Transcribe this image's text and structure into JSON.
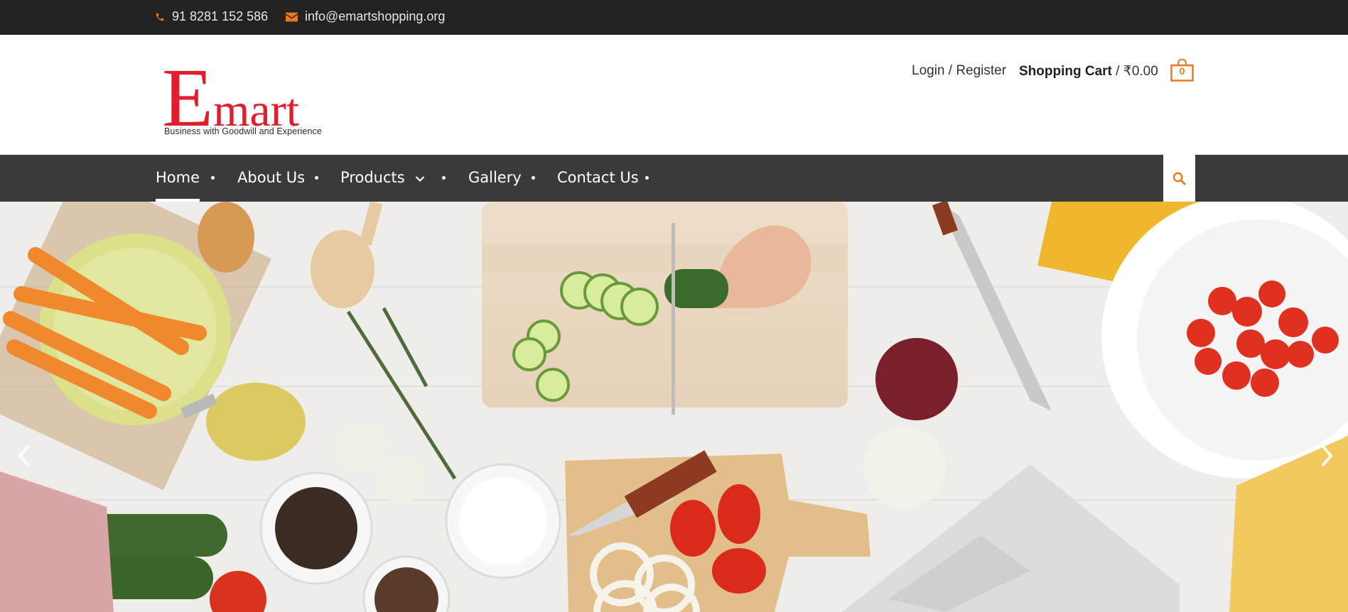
{
  "topbar": {
    "phone": "91 8281 152 586",
    "email": "info@emartshopping.org",
    "icons": [
      "phone-icon",
      "envelope-icon"
    ]
  },
  "header": {
    "logo": {
      "initial": "E",
      "rest": "mart",
      "tagline": "Business with Goodwill and Experience"
    },
    "login_label": "Login / Register",
    "cart_label": "Shopping Cart",
    "cart_total": " / ₹0.00",
    "cart_count": "0"
  },
  "nav": {
    "items": [
      {
        "label": "Home"
      },
      {
        "label": "About Us"
      },
      {
        "label": "Products"
      },
      {
        "label": "Gallery"
      },
      {
        "label": "Contact Us"
      }
    ],
    "active": "Home"
  },
  "colors": {
    "accent": "#e87a1b",
    "brand_red": "#e21d2c",
    "topbar_bg": "#222222",
    "nav_bg": "#3a3a3a"
  }
}
